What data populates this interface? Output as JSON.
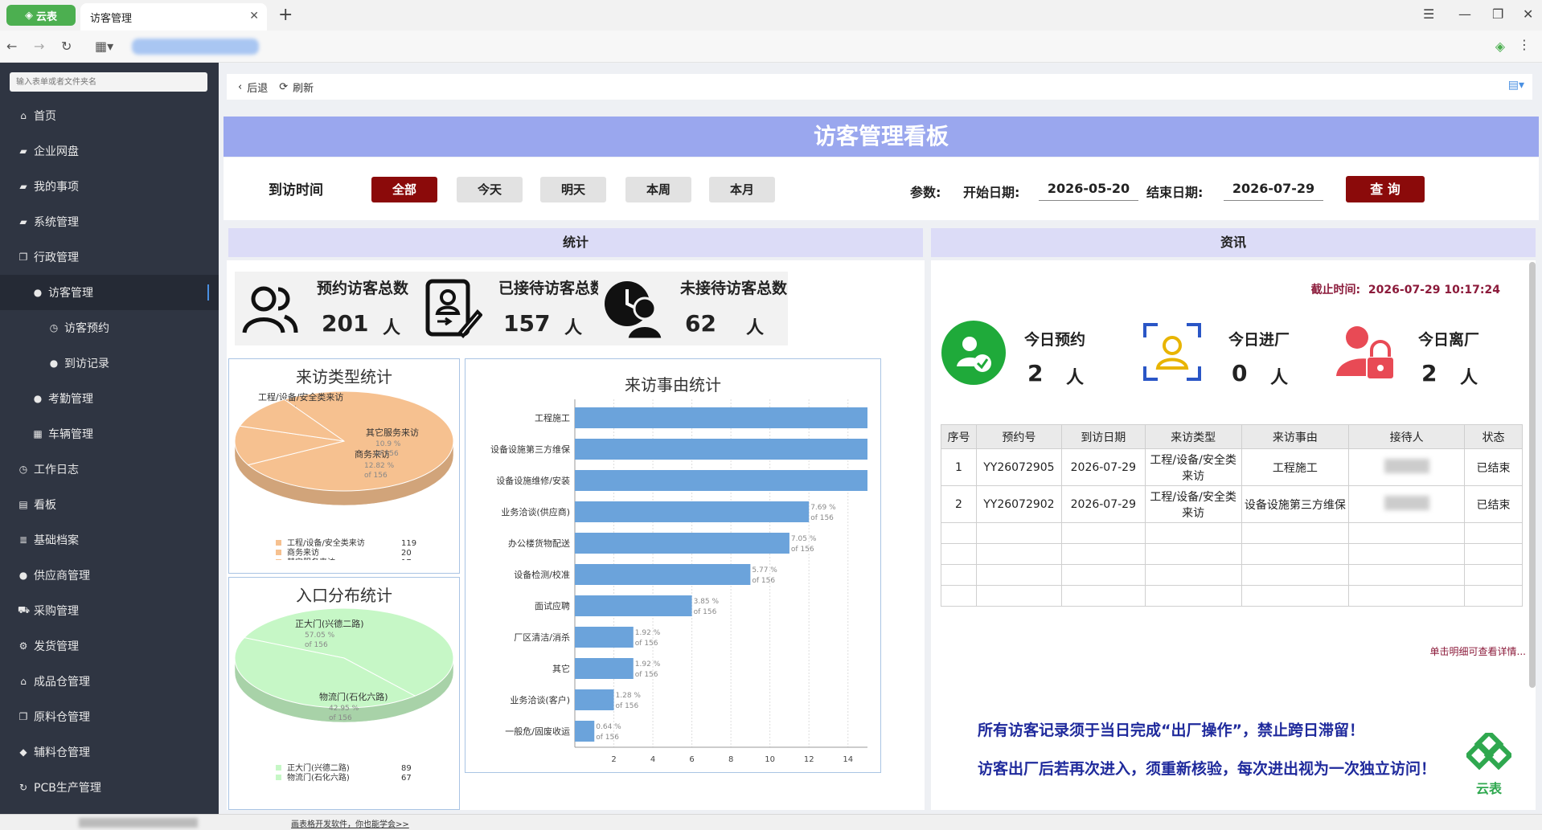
{
  "browser": {
    "app_badge": "云表",
    "tab_title": "访客管理"
  },
  "sidebar": {
    "search_placeholder": "输入表单或者文件夹名",
    "items": [
      {
        "label": "首页",
        "icon": "home-icon"
      },
      {
        "label": "企业网盘",
        "icon": "folder-icon"
      },
      {
        "label": "我的事项",
        "icon": "folder-icon"
      },
      {
        "label": "系统管理",
        "icon": "folder-icon"
      },
      {
        "label": "行政管理",
        "icon": "copy-icon"
      },
      {
        "label": "访客管理",
        "icon": "user-icon"
      },
      {
        "label": "访客预约",
        "icon": "clock-icon"
      },
      {
        "label": "到访记录",
        "icon": "user-icon"
      },
      {
        "label": "考勤管理",
        "icon": "users-icon"
      },
      {
        "label": "车辆管理",
        "icon": "table-icon"
      },
      {
        "label": "工作日志",
        "icon": "clock-icon"
      },
      {
        "label": "看板",
        "icon": "board-icon"
      },
      {
        "label": "基础档案",
        "icon": "list-icon"
      },
      {
        "label": "供应商管理",
        "icon": "users-icon"
      },
      {
        "label": "采购管理",
        "icon": "cart-icon"
      },
      {
        "label": "发货管理",
        "icon": "gear-icon"
      },
      {
        "label": "成品仓管理",
        "icon": "home-icon"
      },
      {
        "label": "原料仓管理",
        "icon": "copy-icon"
      },
      {
        "label": "辅料仓管理",
        "icon": "cube-icon"
      },
      {
        "label": "PCB生产管理",
        "icon": "refresh-icon"
      }
    ]
  },
  "toolbar": {
    "back_label": "后退",
    "refresh_label": "刷新"
  },
  "dashboard": {
    "title": "访客管理看板",
    "filter_label": "到访时间",
    "periods": [
      "全部",
      "今天",
      "明天",
      "本周",
      "本月"
    ],
    "active_period": "全部",
    "param_label": "参数:",
    "start_label": "开始日期:",
    "start_date": "2026-05-20",
    "end_label": "结束日期:",
    "end_date": "2026-07-29",
    "query_label": "查 询"
  },
  "stats": {
    "header": "统计",
    "kpis": [
      {
        "title": "预约访客总数",
        "value": "201",
        "unit": "人"
      },
      {
        "title": "已接待访客总数",
        "value": "157",
        "unit": "人"
      },
      {
        "title": "未接待访客总数",
        "value": "62",
        "unit": "人"
      }
    ]
  },
  "info": {
    "header": "资讯",
    "deadline_label": "截止时间:",
    "deadline_value": "2026-07-29 10:17:24",
    "today": [
      {
        "title": "今日预约",
        "value": "2",
        "unit": "人"
      },
      {
        "title": "今日进厂",
        "value": "0",
        "unit": "人"
      },
      {
        "title": "今日离厂",
        "value": "2",
        "unit": "人"
      }
    ],
    "table": {
      "columns": [
        "序号",
        "预约号",
        "到访日期",
        "来访类型",
        "来访事由",
        "接待人",
        "状态"
      ],
      "rows": [
        [
          "1",
          "YY26072905",
          "2026-07-29",
          "工程/设备/安全类来访",
          "工程施工",
          "",
          "已结束"
        ],
        [
          "2",
          "YY26072902",
          "2026-07-29",
          "工程/设备/安全类来访",
          "设备设施第三方维保",
          "",
          "已结束"
        ]
      ]
    },
    "more_link": "单击明细可查看详情...",
    "notices": [
      "所有访客记录须于当日完成“出厂操作”，禁止跨日滞留！",
      "访客出厂后若再次进入，须重新核验，每次进出视为一次独立访问！"
    ],
    "logo_text": "云表"
  },
  "statusbar": {
    "link": "画表格开发软件，你也能学会>>"
  },
  "chart_data": [
    {
      "type": "pie",
      "title": "来访类型统计",
      "total_label": "of 156",
      "slices": [
        {
          "label": "工程/设备/安全类来访",
          "value": 119,
          "percent": "76.28 %",
          "color": "#f6c190"
        },
        {
          "label": "商务来访",
          "value": 20,
          "percent": "12.82 %",
          "color": "#f6c190"
        },
        {
          "label": "其它服务来访",
          "value": 17,
          "percent": "10.9 %",
          "color": "#f6c190"
        }
      ]
    },
    {
      "type": "pie",
      "title": "入口分布统计",
      "total_label": "of 156",
      "slices": [
        {
          "label": "正大门(兴德二路)",
          "value": 89,
          "percent": "57.05 %",
          "color": "#c6f7c6"
        },
        {
          "label": "物流门(石化六路)",
          "value": 67,
          "percent": "42.95 %",
          "color": "#c6f7c6"
        }
      ]
    },
    {
      "type": "bar",
      "orientation": "horizontal",
      "title": "来访事由统计",
      "total_label": "of 156",
      "xlim": [
        0,
        15
      ],
      "xticks": [
        "2",
        "4",
        "6",
        "8",
        "10",
        "12",
        "14"
      ],
      "categories": [
        "工程施工",
        "设备设施第三方维保",
        "设备设施维修/安装",
        "业务洽谈(供应商)",
        "办公楼货物配送",
        "设备检测/校准",
        "面试应聘",
        "厂区清洁/消杀",
        "其它",
        "业务洽谈(客户)",
        "一般危/固废收运"
      ],
      "values": [
        15,
        15,
        15,
        12,
        11,
        9,
        6,
        3,
        3,
        2,
        1
      ],
      "labels": [
        "",
        "",
        "",
        "7.69 %",
        "7.05 %",
        "5.77 %",
        "3.85 %",
        "1.92 %",
        "1.92 %",
        "1.28 %",
        "0.64 %"
      ],
      "color": "#6ba3db"
    }
  ]
}
